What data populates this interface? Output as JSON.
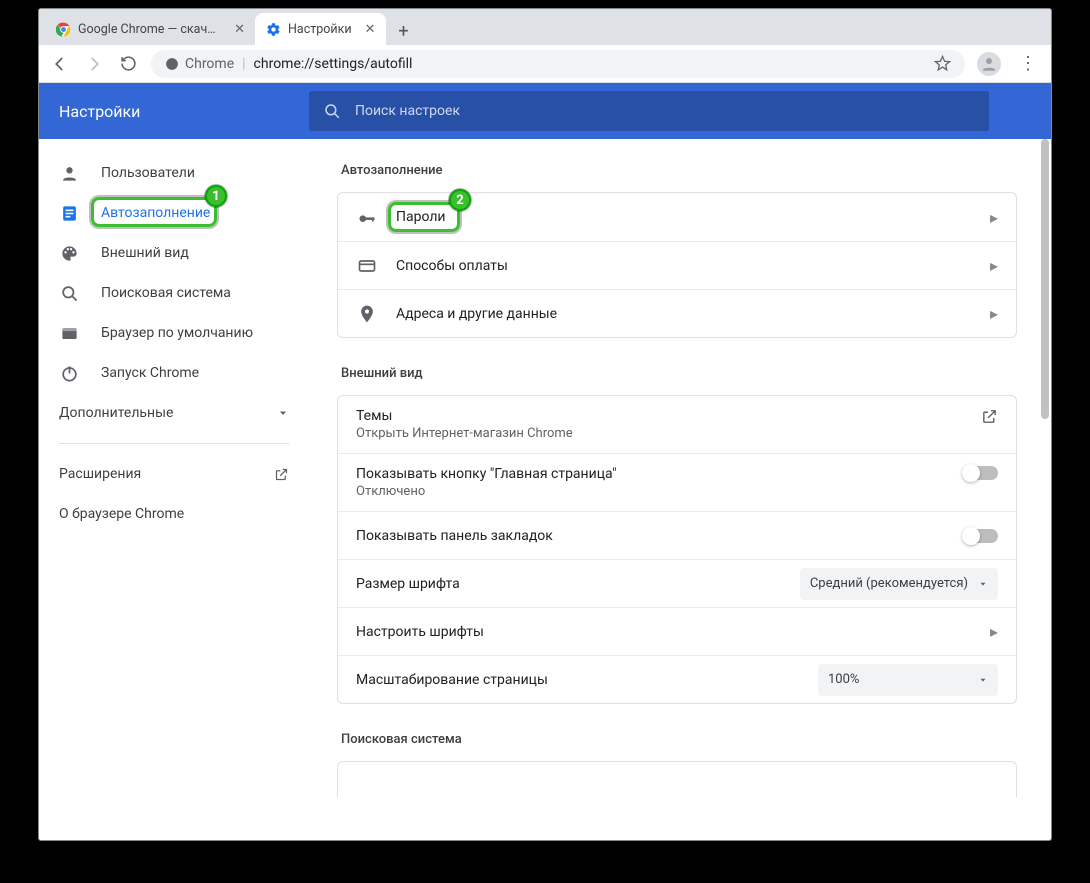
{
  "window": {
    "tabs": [
      {
        "title": "Google Chrome — скачать бесп",
        "active": false
      },
      {
        "title": "Настройки",
        "active": true
      }
    ],
    "url_scheme": "Chrome",
    "url_path": "chrome://settings/autofill"
  },
  "bluebar": {
    "title": "Настройки"
  },
  "search": {
    "placeholder": "Поиск настроек"
  },
  "sidebar": {
    "items": [
      {
        "label": "Пользователи"
      },
      {
        "label": "Автозаполнение"
      },
      {
        "label": "Внешний вид"
      },
      {
        "label": "Поисковая система"
      },
      {
        "label": "Браузер по умолчанию"
      },
      {
        "label": "Запуск Chrome"
      }
    ],
    "advanced": "Дополнительные",
    "extensions": "Расширения",
    "about": "О браузере Chrome"
  },
  "sections": {
    "autofill": {
      "heading": "Автозаполнение",
      "rows": [
        {
          "label": "Пароли"
        },
        {
          "label": "Способы оплаты"
        },
        {
          "label": "Адреса и другие данные"
        }
      ]
    },
    "appearance": {
      "heading": "Внешний вид",
      "themes": {
        "label": "Темы",
        "sub": "Открыть Интернет-магазин Chrome"
      },
      "homebtn": {
        "label": "Показывать кнопку \"Главная страница\"",
        "sub": "Отключено"
      },
      "bookmarks": {
        "label": "Показывать панель закладок"
      },
      "fontsize": {
        "label": "Размер шрифта",
        "value": "Средний (рекомендуется)"
      },
      "customfonts": {
        "label": "Настроить шрифты"
      },
      "zoom": {
        "label": "Масштабирование страницы",
        "value": "100%"
      }
    },
    "search": {
      "heading": "Поисковая система"
    }
  },
  "callouts": {
    "one": "1",
    "two": "2"
  }
}
